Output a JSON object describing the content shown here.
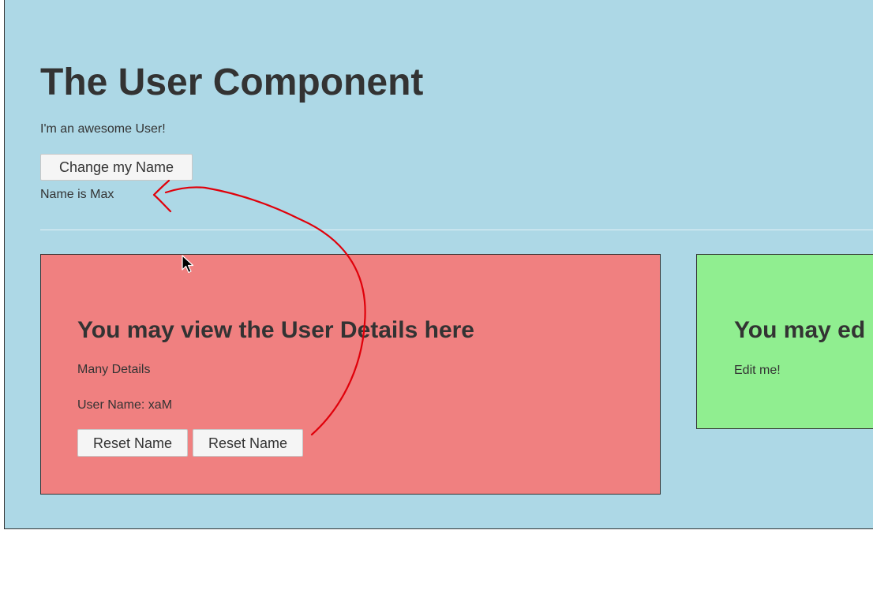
{
  "user_component": {
    "title": "The User Component",
    "subtitle": "I'm an awesome User!",
    "change_name_button": "Change my Name",
    "name_status": "Name is Max"
  },
  "user_detail": {
    "heading": "You may view the User Details here",
    "details_text": "Many Details",
    "user_name_line": "User Name: xaM",
    "reset_button_1": "Reset Name",
    "reset_button_2": "Reset Name"
  },
  "user_edit": {
    "heading": "You may ed",
    "text": "Edit me!"
  },
  "colors": {
    "component_bg": "#add8e6",
    "detail_bg": "#f08080",
    "edit_bg": "#90ee90",
    "annotation_stroke": "#e0000a"
  },
  "icons": {
    "cursor": "mouse-pointer-icon",
    "annotation": "hand-drawn-arrow"
  }
}
